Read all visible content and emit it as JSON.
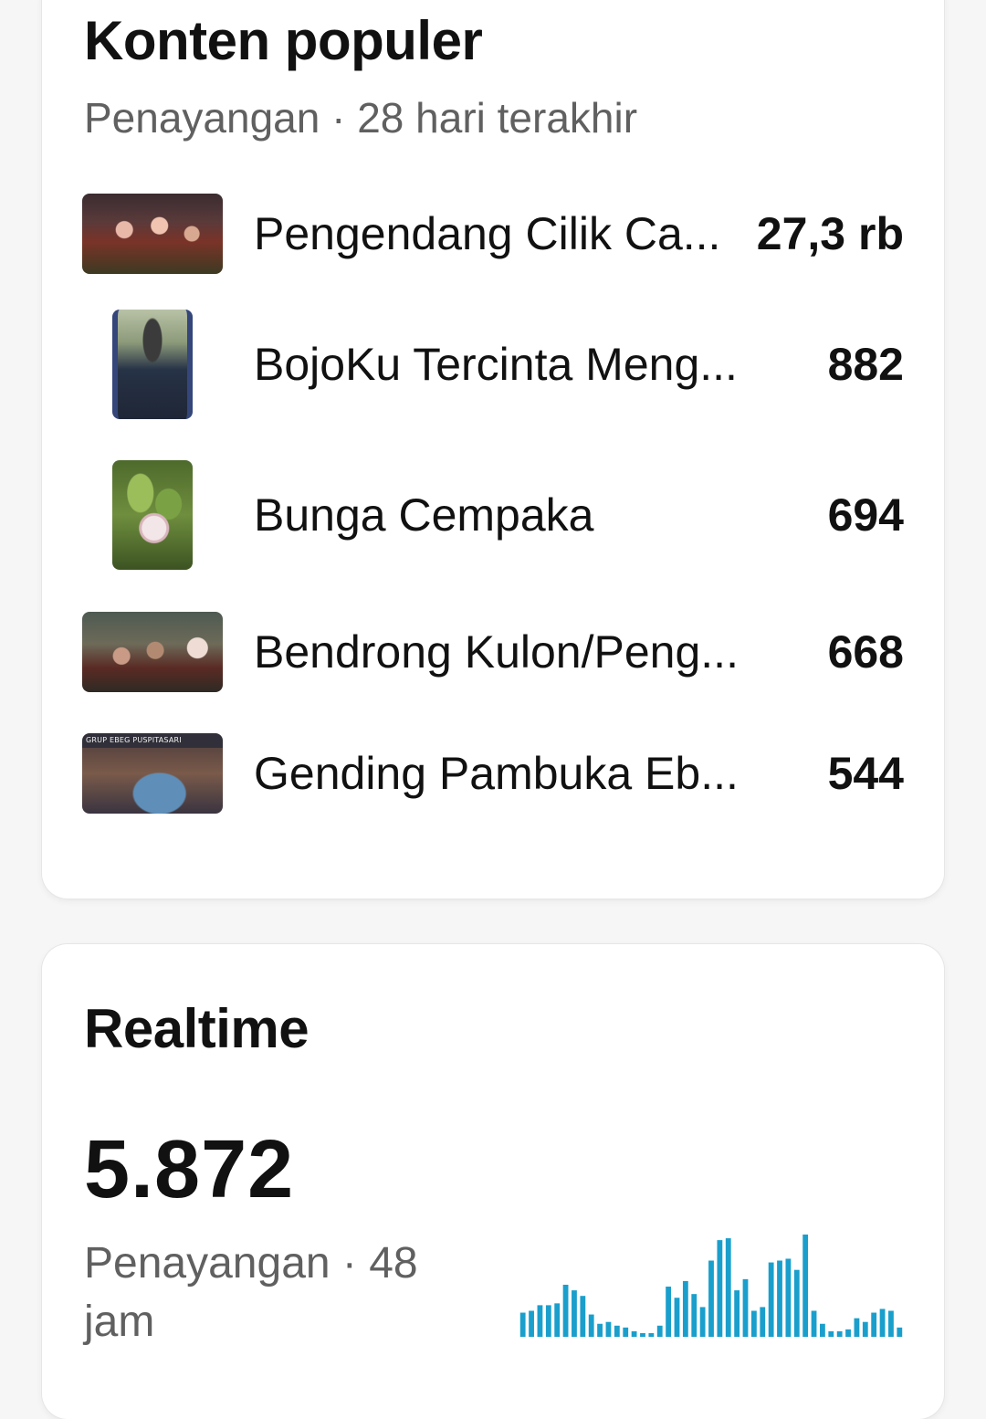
{
  "popular": {
    "title": "Konten populer",
    "subtitle": "Penayangan · 28 hari terakhir",
    "items": [
      {
        "title": "Pengendang Cilik Ca...",
        "value": "27,3 rb",
        "thumb": "wide"
      },
      {
        "title": "BojoKu Tercinta Meng...",
        "value": "882",
        "thumb": "tall"
      },
      {
        "title": "Bunga Cempaka",
        "value": "694",
        "thumb": "tall"
      },
      {
        "title": "Bendrong Kulon/Peng...",
        "value": "668",
        "thumb": "wide"
      },
      {
        "title": "Gending Pambuka Eb...",
        "value": "544",
        "thumb": "wide",
        "thumb_text": "GRUP EBEG PUSPITASARI"
      }
    ]
  },
  "realtime": {
    "title": "Realtime",
    "value": "5.872",
    "caption": "Penayangan · 48 jam",
    "bar_color": "#1a9fcc",
    "chart_data": {
      "type": "bar",
      "values": [
        26,
        28,
        34,
        34,
        36,
        56,
        50,
        44,
        24,
        14,
        16,
        12,
        10,
        6,
        4,
        4,
        12,
        54,
        42,
        60,
        46,
        32,
        82,
        104,
        106,
        50,
        62,
        28,
        32,
        80,
        82,
        84,
        72,
        110,
        28,
        14,
        6,
        6,
        8,
        20,
        16,
        26,
        30,
        28,
        10
      ]
    }
  }
}
